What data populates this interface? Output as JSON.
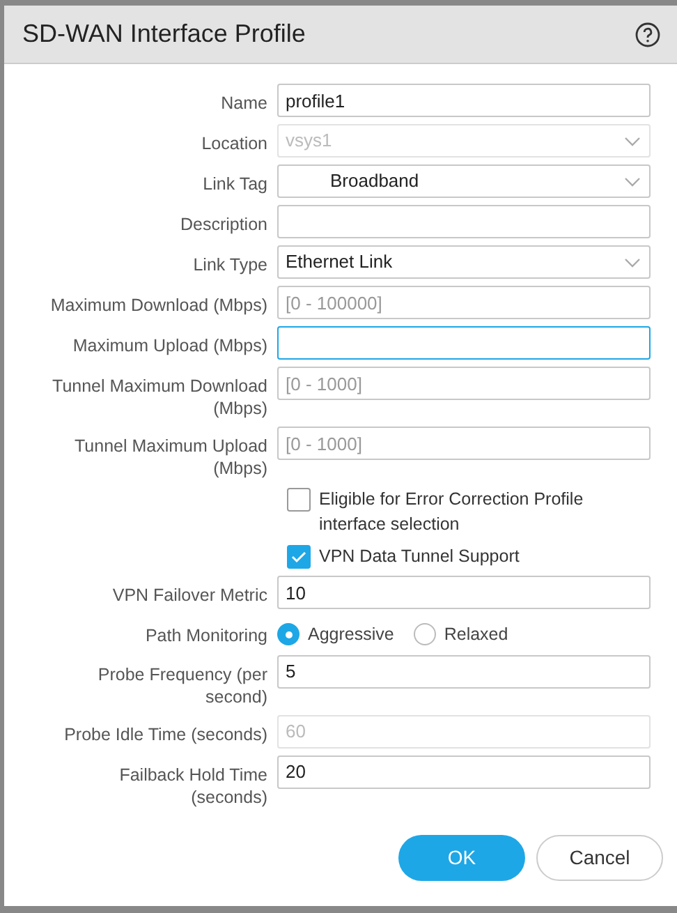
{
  "dialog": {
    "title": "SD-WAN Interface Profile"
  },
  "fields": [
    {
      "kind": "text",
      "label": "Name",
      "value": "profile1",
      "disabled": false,
      "focused": false
    },
    {
      "kind": "select",
      "label": "Location",
      "value": "vsys1",
      "disabled": true
    },
    {
      "kind": "select",
      "label": "Link Tag",
      "value": "Broadband",
      "disabled": false
    },
    {
      "kind": "text",
      "label": "Description",
      "disabled": false,
      "focused": false
    },
    {
      "kind": "select",
      "label": "Link Type",
      "value": "Ethernet Link",
      "disabled": false
    },
    {
      "kind": "text",
      "label": "Maximum Download (Mbps)",
      "placeholder": "[0 - 100000]",
      "disabled": false,
      "focused": false
    },
    {
      "kind": "text",
      "label": "Maximum Upload (Mbps)",
      "disabled": false,
      "focused": true
    },
    {
      "kind": "text",
      "label": "Tunnel Maximum Download (Mbps)",
      "placeholder": "[0 - 1000]",
      "disabled": false,
      "focused": false
    },
    {
      "kind": "text",
      "label": "Tunnel Maximum Upload (Mbps)",
      "placeholder": "[0 - 1000]",
      "disabled": false,
      "focused": false
    },
    {
      "kind": "checkbox",
      "label": "Eligible for Error Correction Profile interface selection",
      "checked": false
    },
    {
      "kind": "checkbox",
      "label": "VPN Data Tunnel Support",
      "checked": true
    },
    {
      "kind": "text",
      "label": "VPN Failover Metric",
      "value": "10",
      "disabled": false,
      "focused": false
    },
    {
      "kind": "radio",
      "label": "Path Monitoring",
      "options": [
        {
          "label": "Aggressive",
          "selected": true
        },
        {
          "label": "Relaxed",
          "selected": false
        }
      ]
    },
    {
      "kind": "text",
      "label": "Probe Frequency (per second)",
      "value": "5",
      "disabled": false,
      "focused": false
    },
    {
      "kind": "text",
      "label": "Probe Idle Time (seconds)",
      "value": "60",
      "disabled": true,
      "focused": false
    },
    {
      "kind": "text",
      "label": "Failback Hold Time (seconds)",
      "value": "20",
      "disabled": false,
      "focused": false
    }
  ],
  "buttons": [
    {
      "label": "OK",
      "kind": "primary"
    },
    {
      "label": "Cancel",
      "kind": "secondary"
    }
  ]
}
